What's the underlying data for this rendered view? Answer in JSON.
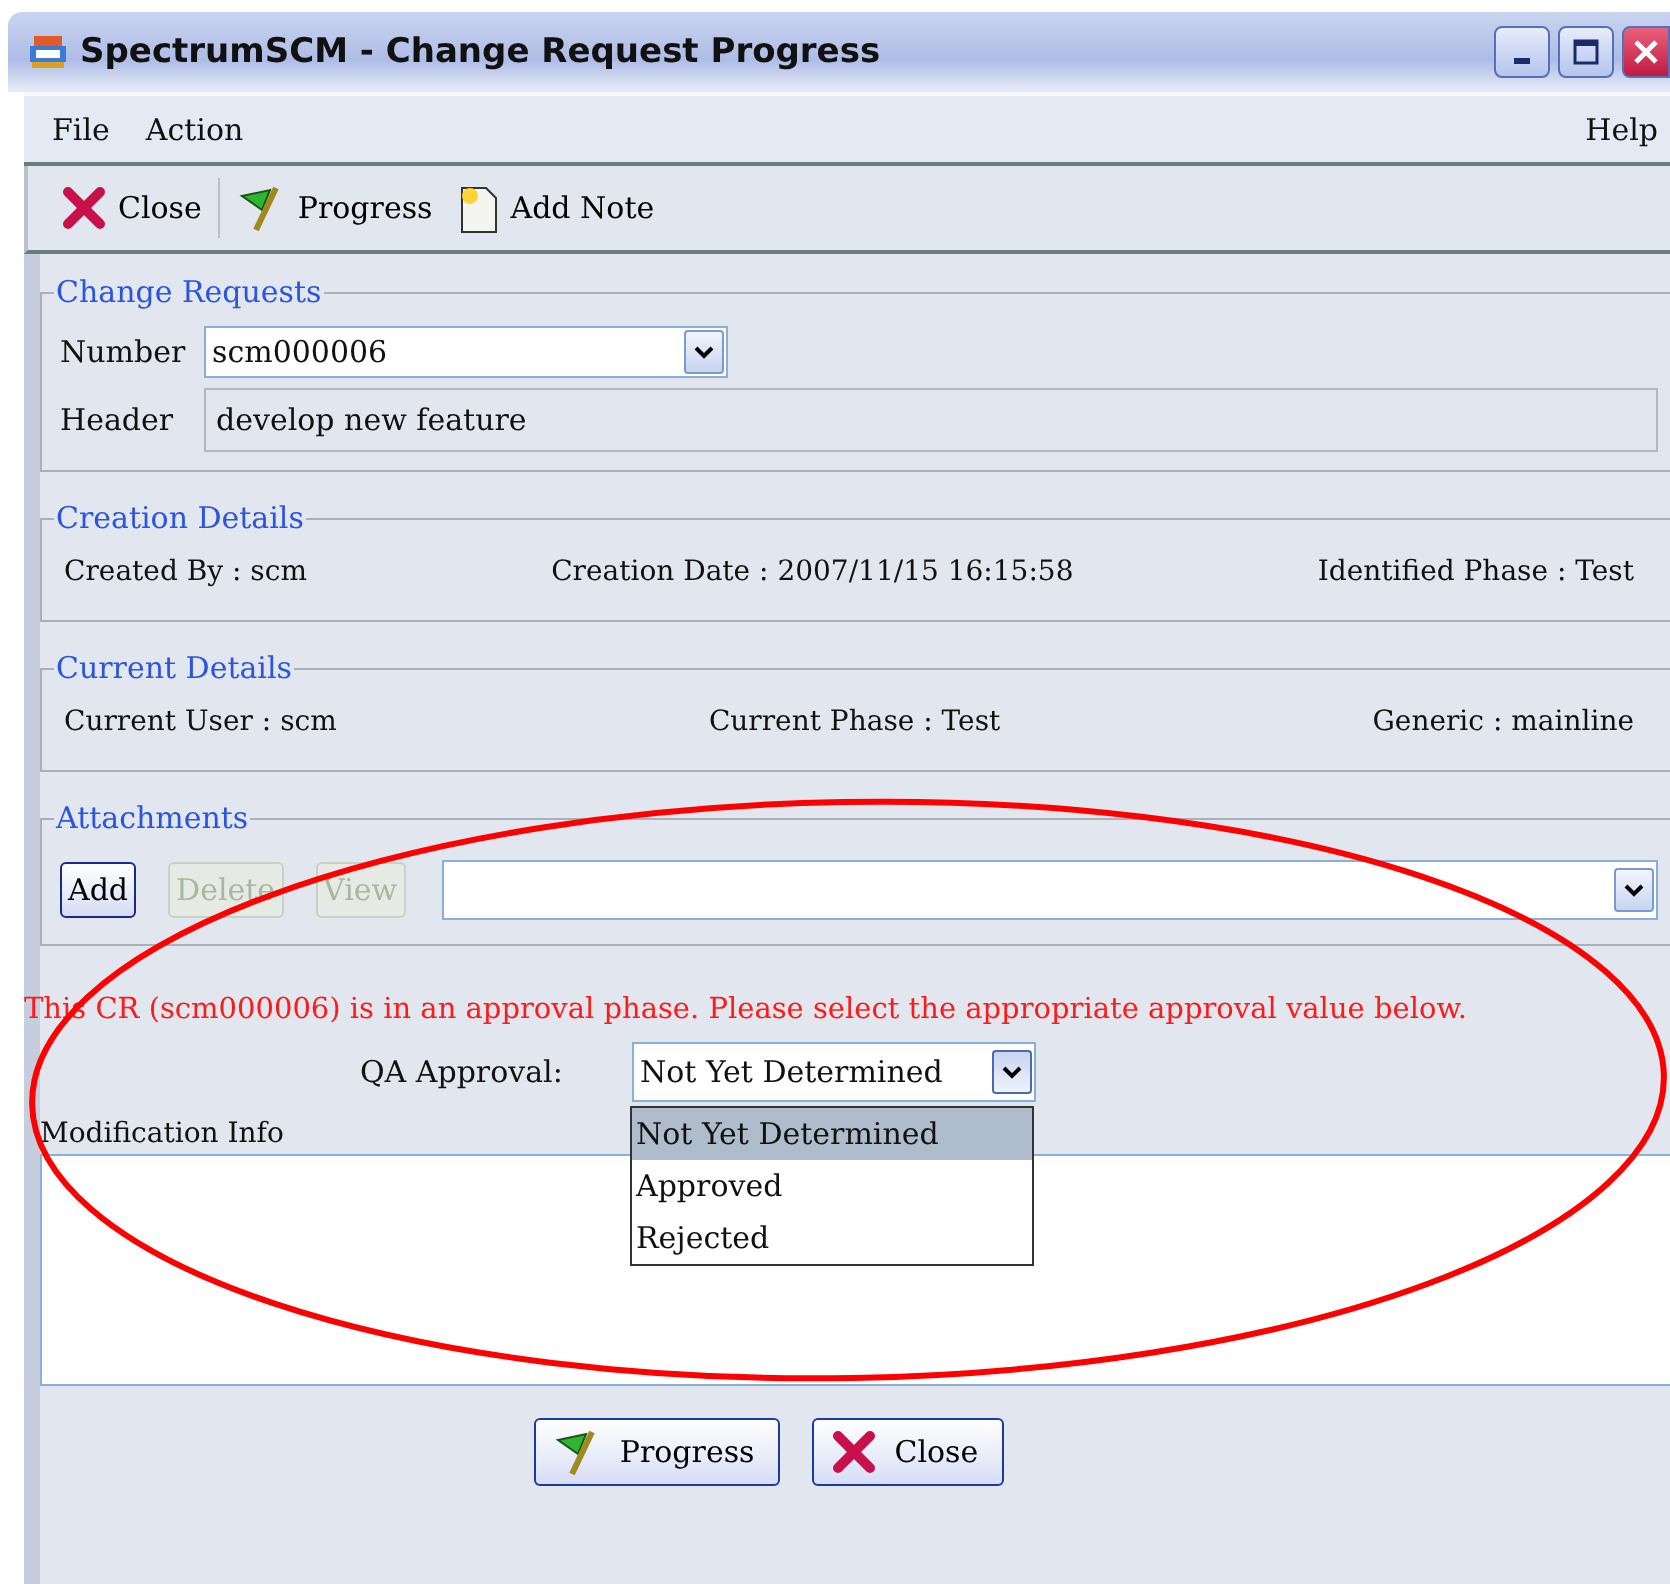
{
  "window": {
    "title": "SpectrumSCM - Change Request Progress"
  },
  "menu": [
    {
      "label": "File"
    },
    {
      "label": "Action"
    }
  ],
  "help_menu": {
    "label": "Help"
  },
  "toolbar": [
    {
      "label": "Close",
      "kind": "close"
    },
    {
      "label": "Progress",
      "kind": "progress"
    },
    {
      "label": "Add Note",
      "kind": "note"
    }
  ],
  "change_requests": {
    "legend": "Change Requests",
    "number_label": "Number",
    "number": "scm000006",
    "header_label": "Header",
    "header": "develop new feature"
  },
  "creation_details": {
    "legend": "Creation Details",
    "fields": [
      "Created By : scm",
      "Creation Date : 2007/11/15 16:15:58",
      "Identified Phase : Test"
    ]
  },
  "current_details": {
    "legend": "Current Details",
    "fields": [
      "Current User : scm",
      "Current Phase : Test",
      "Generic : mainline"
    ]
  },
  "attachments": {
    "legend": "Attachments",
    "buttons": [
      {
        "label": "Add",
        "disabled": false
      },
      {
        "label": "Delete",
        "disabled": true
      },
      {
        "label": "View",
        "disabled": true
      }
    ]
  },
  "message": "This CR (scm000006) is in an approval phase. Please select the appropriate approval value below.",
  "qa_approval": {
    "label": "QA Approval:",
    "value": "Not Yet Determined",
    "expanded": true,
    "options": [
      {
        "label": "Not Yet Determined",
        "selected": true
      },
      {
        "label": "Approved",
        "selected": false
      },
      {
        "label": "Rejected",
        "selected": false
      }
    ]
  },
  "modification_info": {
    "label": "Modification Info"
  },
  "buttons": [
    {
      "label": "Progress",
      "kind": "progress"
    },
    {
      "label": "Close",
      "kind": "close"
    }
  ]
}
